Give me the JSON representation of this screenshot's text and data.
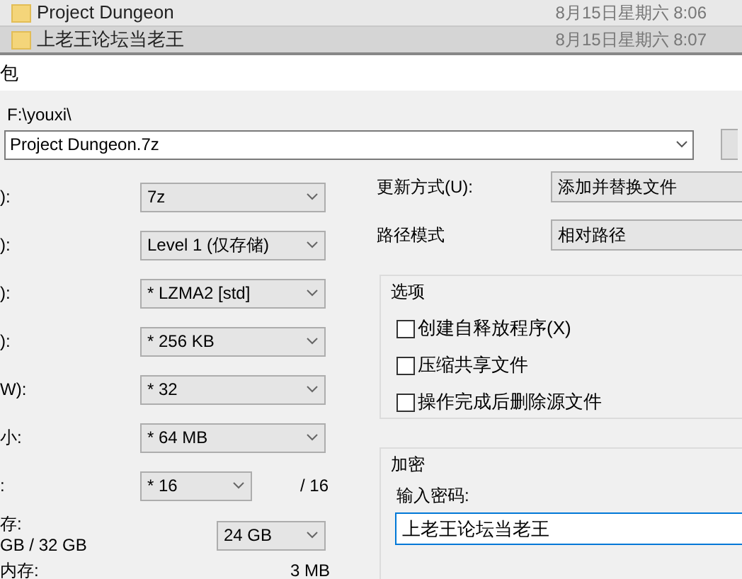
{
  "files": [
    {
      "name": "Project Dungeon",
      "date": "8月15日星期六 8:06",
      "selected": false
    },
    {
      "name": "上老王论坛当老王",
      "date": "8月15日星期六 8:07",
      "selected": true
    }
  ],
  "dialog": {
    "title": "包"
  },
  "archive": {
    "path": "F:\\youxi\\",
    "name": "Project Dungeon.7z"
  },
  "left_options": [
    {
      "kind": "combo",
      "label": "):",
      "value": "7z"
    },
    {
      "kind": "combo",
      "label": "):",
      "value": "Level 1 (仅存储)"
    },
    {
      "kind": "combo",
      "label": "):",
      "value": "* LZMA2 [std]"
    },
    {
      "kind": "combo",
      "label": "):",
      "value": "* 256 KB"
    },
    {
      "kind": "combo",
      "label": "W):",
      "value": "* 32"
    },
    {
      "kind": "combo",
      "label": "小:",
      "value": "* 64 MB"
    },
    {
      "kind": "threads",
      "label": ":",
      "value": "* 16",
      "suffix": "/ 16"
    },
    {
      "kind": "memory",
      "label": "存:",
      "sublabel": "GB / 32 GB",
      "value": "24 GB"
    },
    {
      "kind": "readout",
      "label": "内存:",
      "value": "3 MB"
    }
  ],
  "update_mode": {
    "label": "更新方式(U):",
    "value": "添加并替换文件"
  },
  "path_mode": {
    "label": "路径模式",
    "value": "相对路径"
  },
  "options": {
    "title": "选项",
    "items": [
      {
        "label": "创建自释放程序(X)",
        "checked": false
      },
      {
        "label": "压缩共享文件",
        "checked": false
      },
      {
        "label": "操作完成后删除源文件",
        "checked": false
      }
    ]
  },
  "encryption": {
    "title": "加密",
    "password_label": "输入密码:",
    "password": "上老王论坛当老王"
  }
}
